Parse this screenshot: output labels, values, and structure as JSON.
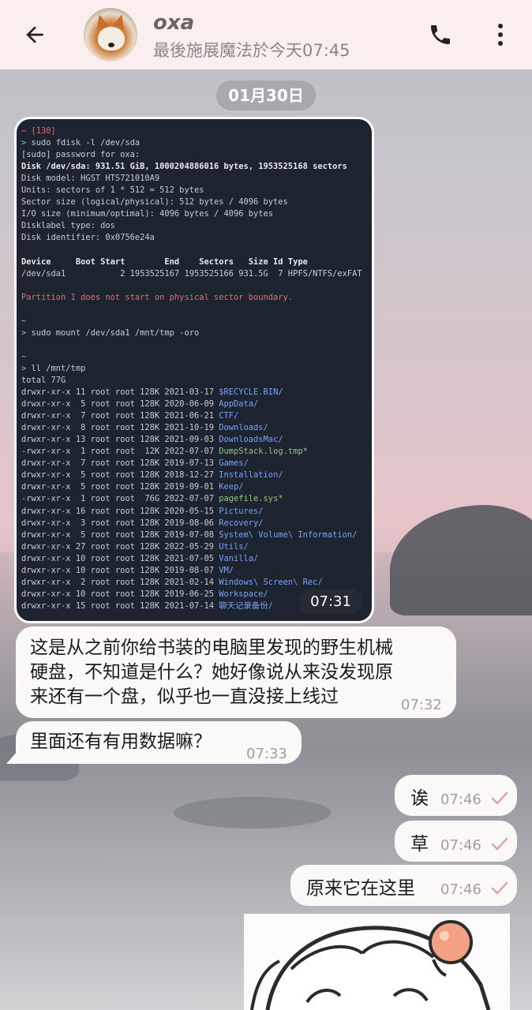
{
  "header": {
    "contact_name": "oxa",
    "status": "最後施展魔法於今天07:45"
  },
  "date_chip": "01月30日",
  "terminal": {
    "time": "07:31",
    "lines": {
      "l0": "~ [130]",
      "l1_cmd": "sudo fdisk -l /dev/sda",
      "l2": "[sudo] password for oxa:",
      "l3": "Disk /dev/sda: 931.51 GiB, 1000204886016 bytes, 1953525168 sectors",
      "l4": "Disk model: HGST HTS721010A9",
      "l5": "Units: sectors of 1 * 512 = 512 bytes",
      "l6": "Sector size (logical/physical): 512 bytes / 4096 bytes",
      "l7": "I/O size (minimum/optimal): 4096 bytes / 4096 bytes",
      "l8": "Disklabel type: dos",
      "l9": "Disk identifier: 0x0756e24a",
      "l11": "Device     Boot Start        End    Sectors   Size Id Type",
      "l12": "/dev/sda1           2 1953525167 1953525166 931.5G  7 HPFS/NTFS/exFAT",
      "l14": "Partition 1 does not start on physical sector boundary.",
      "l16": "~",
      "l17_cmd": "sudo mount /dev/sda1 /mnt/tmp -oro",
      "l19": "~",
      "l20_cmd": "ll /mnt/tmp",
      "l21": "total 77G"
    },
    "entries": [
      {
        "meta": "drwxr-xr-x 11 root root 128K 2021-03-17",
        "name": "$RECYCLE.BIN/",
        "color": "blue"
      },
      {
        "meta": "drwxr-xr-x  5 root root 128K 2020-06-09",
        "name": "AppData/",
        "color": "blue"
      },
      {
        "meta": "drwxr-xr-x  7 root root 128K 2021-06-21",
        "name": "CTF/",
        "color": "blue"
      },
      {
        "meta": "drwxr-xr-x  8 root root 128K 2021-10-19",
        "name": "Downloads/",
        "color": "blue"
      },
      {
        "meta": "drwxr-xr-x 13 root root 128K 2021-09-03",
        "name": "DownloadsMac/",
        "color": "blue"
      },
      {
        "meta": "-rwxr-xr-x  1 root root  12K 2022-07-07",
        "name": "DumpStack.log.tmp*",
        "color": "green"
      },
      {
        "meta": "drwxr-xr-x  7 root root 128K 2019-07-13",
        "name": "Games/",
        "color": "blue"
      },
      {
        "meta": "drwxr-xr-x  5 root root 128K 2018-12-27",
        "name": "Installation/",
        "color": "blue"
      },
      {
        "meta": "drwxr-xr-x  5 root root 128K 2019-09-01",
        "name": "Keep/",
        "color": "blue"
      },
      {
        "meta": "-rwxr-xr-x  1 root root  76G 2022-07-07",
        "name": "pagefile.sys*",
        "color": "green"
      },
      {
        "meta": "drwxr-xr-x 16 root root 128K 2020-05-15",
        "name": "Pictures/",
        "color": "blue"
      },
      {
        "meta": "drwxr-xr-x  3 root root 128K 2019-08-06",
        "name": "Recovery/",
        "color": "blue"
      },
      {
        "meta": "drwxr-xr-x  5 root root 128K 2019-07-08",
        "name": "System\\ Volume\\ Information/",
        "color": "blue"
      },
      {
        "meta": "drwxr-xr-x 27 root root 128K 2022-05-29",
        "name": "Utils/",
        "color": "blue"
      },
      {
        "meta": "drwxr-xr-x 10 root root 128K 2021-07-05",
        "name": "Vanilla/",
        "color": "blue"
      },
      {
        "meta": "drwxr-xr-x 10 root root 128K 2019-08-07",
        "name": "VM/",
        "color": "blue"
      },
      {
        "meta": "drwxr-xr-x  2 root root 128K 2021-02-14",
        "name": "Windows\\ Screen\\ Rec/",
        "color": "blue"
      },
      {
        "meta": "drwxr-xr-x 10 root root 128K 2019-06-25",
        "name": "Workspace/",
        "color": "blue"
      },
      {
        "meta": "drwxr-xr-x 15 root root 128K 2021-07-14",
        "name": "聊天记录备份/",
        "color": "blue"
      }
    ]
  },
  "messages_in": [
    {
      "lines": [
        "这是从之前你给书装的电脑里发现的野生机械",
        "硬盘，不知道是什么？她好像说从来没发现原",
        "来还有一个盘，似乎也一直没接上线过"
      ],
      "time": "07:32"
    },
    {
      "text": "里面还有有用数据嘛？",
      "time": "07:33"
    }
  ],
  "messages_out": [
    {
      "text": "诶",
      "time": "07:46"
    },
    {
      "text": "草",
      "time": "07:46"
    },
    {
      "text": "原来它在这里",
      "time": "07:46"
    }
  ],
  "colors": {
    "header_bg": "#fbeeee",
    "bubble_bg": "#fbf8f8",
    "terminal_bg": "#1d2430",
    "check": "#d9a2a8"
  }
}
